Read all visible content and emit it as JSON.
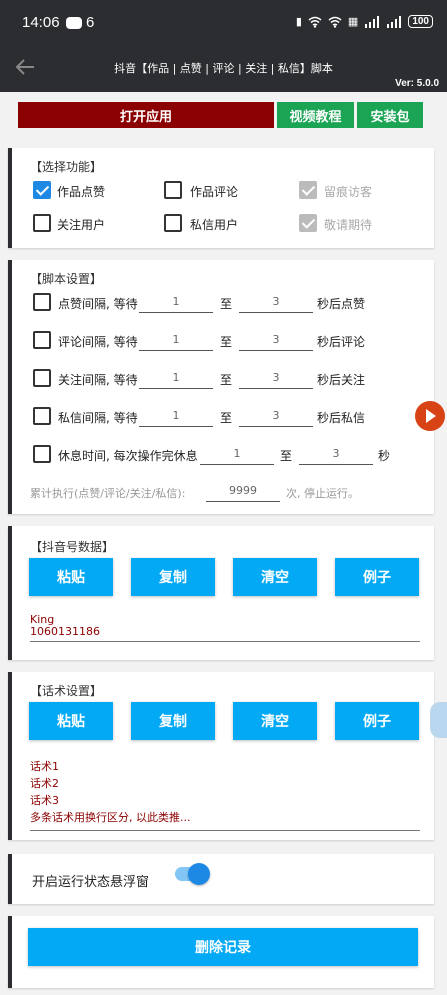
{
  "status": {
    "time": "14:06",
    "notif_count": "6",
    "battery": "100"
  },
  "app": {
    "title": "抖音【作品 | 点赞 | 评论 | 关注 | 私信】脚本",
    "version": "Ver: 5.0.0"
  },
  "top_buttons": {
    "open": "打开应用",
    "video": "视频教程",
    "package": "安装包"
  },
  "functions": {
    "title": "【选择功能】",
    "like": {
      "label": "作品点赞",
      "checked": true
    },
    "comment": {
      "label": "作品评论",
      "checked": false
    },
    "visit": {
      "label": "留痕访客",
      "checked": true,
      "disabled": true
    },
    "follow": {
      "label": "关注用户",
      "checked": false
    },
    "message": {
      "label": "私信用户",
      "checked": false
    },
    "coming": {
      "label": "敬请期待",
      "checked": true,
      "disabled": true
    }
  },
  "script": {
    "title": "【脚本设置】",
    "to": "至",
    "rows": [
      {
        "label": "点赞间隔, 等待",
        "min": "1",
        "max": "3",
        "suffix": "秒后点赞"
      },
      {
        "label": "评论间隔, 等待",
        "min": "1",
        "max": "3",
        "suffix": "秒后评论"
      },
      {
        "label": "关注间隔, 等待",
        "min": "1",
        "max": "3",
        "suffix": "秒后关注"
      },
      {
        "label": "私信间隔, 等待",
        "min": "1",
        "max": "3",
        "suffix": "秒后私信"
      },
      {
        "label": "休息时间, 每次操作完休息",
        "min": "1",
        "max": "3",
        "suffix": "秒"
      }
    ],
    "total_label": "累计执行(点赞/评论/关注/私信):",
    "total_value": "9999",
    "total_suffix": "次, 停止运行。"
  },
  "accounts": {
    "title": "【抖音号数据】",
    "lines": [
      "King",
      "1060131186"
    ]
  },
  "scripts_text": {
    "title": "【话术设置】",
    "lines": [
      "话术1",
      "话术2",
      "话术3",
      "多条话术用换行区分, 以此类推..."
    ]
  },
  "buttons": {
    "paste": "粘贴",
    "copy": "复制",
    "clear": "清空",
    "example": "例子"
  },
  "floating": {
    "label": "开启运行状态悬浮窗",
    "enabled": true
  },
  "delete": "删除记录"
}
